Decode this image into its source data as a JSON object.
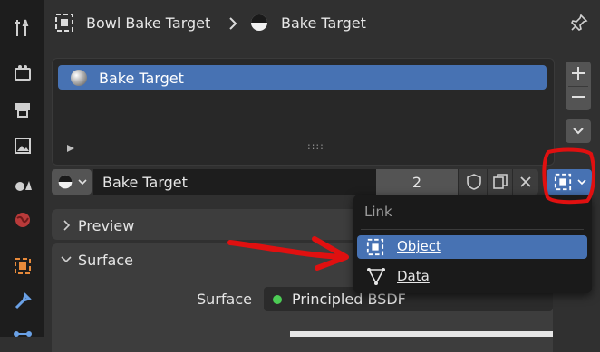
{
  "header": {
    "object_name": "Bowl Bake Target",
    "material_name": "Bake Target"
  },
  "slot_list": {
    "items": [
      {
        "label": "Bake Target"
      }
    ],
    "drag_handle": "::::"
  },
  "material_selector": {
    "name": "Bake Target",
    "users": "2"
  },
  "panels": {
    "preview": "Preview",
    "surface": "Surface"
  },
  "surface_field": {
    "label": "Surface",
    "value": "Principled BSDF",
    "dot_color": "#4ccc55"
  },
  "link_menu": {
    "title": "Link",
    "items": [
      {
        "label": "Object",
        "selected": true
      },
      {
        "label": "Data",
        "selected": false
      }
    ]
  },
  "colors": {
    "accent": "#4772b3",
    "annotation": "#e01010"
  }
}
